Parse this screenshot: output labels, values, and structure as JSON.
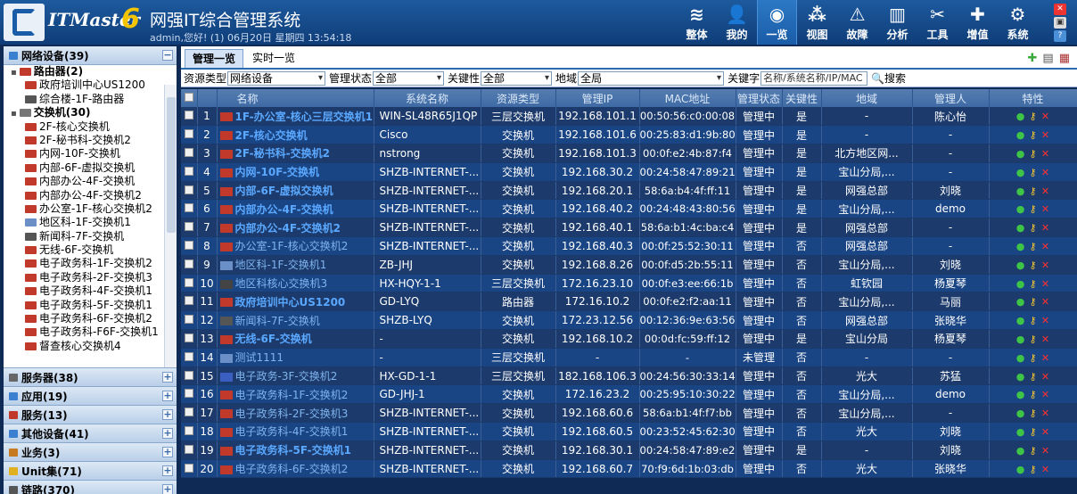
{
  "app": {
    "logo": "ITMaster",
    "version": "6",
    "title": "网强IT综合管理系统",
    "welcome": "admin,您好! (1) 06月20日 星期四 13:54:18"
  },
  "nav": [
    {
      "label": "整体",
      "icon": "layers-icon",
      "glyph": "≋"
    },
    {
      "label": "我的",
      "icon": "user-icon",
      "glyph": "👤"
    },
    {
      "label": "一览",
      "icon": "overview-icon",
      "glyph": "◉",
      "active": true
    },
    {
      "label": "视图",
      "icon": "topology-icon",
      "glyph": "⁂"
    },
    {
      "label": "故障",
      "icon": "warning-icon",
      "glyph": "⚠"
    },
    {
      "label": "分析",
      "icon": "chart-icon",
      "glyph": "▥"
    },
    {
      "label": "工具",
      "icon": "tools-icon",
      "glyph": "✂"
    },
    {
      "label": "增值",
      "icon": "plus-icon",
      "glyph": "✚"
    },
    {
      "label": "系统",
      "icon": "gear-icon",
      "glyph": "⚙"
    }
  ],
  "sidebar": {
    "header": "网络设备(39)",
    "tree": [
      {
        "label": "路由器(2)",
        "level": 0,
        "group": true,
        "color": "#c0392b"
      },
      {
        "label": "政府培训中心US1200",
        "level": 1,
        "color": "#c0392b"
      },
      {
        "label": "综合楼-1F-路由器",
        "level": 1,
        "color": "#555"
      },
      {
        "label": "交换机(30)",
        "level": 0,
        "group": true,
        "color": "#777"
      },
      {
        "label": "2F-核心交换机",
        "level": 1,
        "color": "#c0392b"
      },
      {
        "label": "2F-秘书科-交换机2",
        "level": 1,
        "color": "#c0392b"
      },
      {
        "label": "内网-10F-交换机",
        "level": 1,
        "color": "#c0392b"
      },
      {
        "label": "内部-6F-虚拟交换机",
        "level": 1,
        "color": "#c0392b"
      },
      {
        "label": "内部办公-4F-交换机",
        "level": 1,
        "color": "#c0392b"
      },
      {
        "label": "内部办公-4F-交换机2",
        "level": 1,
        "color": "#c0392b"
      },
      {
        "label": "办公室-1F-核心交换机2",
        "level": 1,
        "color": "#c0392b"
      },
      {
        "label": "地区科-1F-交换机1",
        "level": 1,
        "color": "#6b8fc7"
      },
      {
        "label": "新闻科-7F-交换机",
        "level": 1,
        "color": "#555"
      },
      {
        "label": "无线-6F-交换机",
        "level": 1,
        "color": "#c0392b"
      },
      {
        "label": "电子政务科-1F-交换机2",
        "level": 1,
        "color": "#c0392b"
      },
      {
        "label": "电子政务科-2F-交换机3",
        "level": 1,
        "color": "#c0392b"
      },
      {
        "label": "电子政务科-4F-交换机1",
        "level": 1,
        "color": "#c0392b"
      },
      {
        "label": "电子政务科-5F-交换机1",
        "level": 1,
        "color": "#c0392b"
      },
      {
        "label": "电子政务科-6F-交换机2",
        "level": 1,
        "color": "#c0392b"
      },
      {
        "label": "电子政务科-F6F-交换机1",
        "level": 1,
        "color": "#c0392b"
      },
      {
        "label": "督查核心交换机4",
        "level": 1,
        "color": "#c0392b"
      }
    ],
    "categories": [
      {
        "label": "服务器(38)",
        "color": "#666"
      },
      {
        "label": "应用(19)",
        "color": "#3a7fd0"
      },
      {
        "label": "服务(13)",
        "color": "#c0392b"
      },
      {
        "label": "其他设备(41)",
        "color": "#3a7fd0"
      },
      {
        "label": "业务(3)",
        "color": "#c87a20"
      },
      {
        "label": "Unit集(71)",
        "color": "#e0b020"
      },
      {
        "label": "链路(370)",
        "color": "#555"
      }
    ]
  },
  "tabs": [
    "管理一览",
    "实时一览"
  ],
  "filter": {
    "type_label": "资源类型",
    "type_value": "网络设备",
    "status_label": "管理状态",
    "status_value": "全部",
    "key_label": "关键性",
    "key_value": "全部",
    "region_label": "地域",
    "region_value": "全局",
    "keyword_label": "关键字",
    "keyword_placeholder": "名称/系统名称/IP/MAC",
    "search_label": "搜索"
  },
  "columns": [
    "名称",
    "系统名称",
    "资源类型",
    "管理IP",
    "MAC地址",
    "管理状态",
    "关键性",
    "地域",
    "管理人",
    "特性"
  ],
  "rows": [
    {
      "n": "1",
      "name": "1F-办公室-核心三层交换机1",
      "sys": "WIN-SL48R65J1QP",
      "type": "三层交换机",
      "ip": "192.168.101.1",
      "mac": "00:50:56:c0:00:08",
      "status": "管理中",
      "key": "是",
      "region": "-",
      "owner": "陈心怡",
      "icon": "#c0392b",
      "bold": true
    },
    {
      "n": "2",
      "name": "2F-核心交换机",
      "sys": "Cisco",
      "type": "交换机",
      "ip": "192.168.101.6",
      "mac": "00:25:83:d1:9b:80",
      "status": "管理中",
      "key": "是",
      "region": "-",
      "owner": "-",
      "icon": "#c0392b",
      "bold": true
    },
    {
      "n": "3",
      "name": "2F-秘书科-交换机2",
      "sys": "nstrong",
      "type": "交换机",
      "ip": "192.168.101.3",
      "mac": "00:0f:e2:4b:87:f4",
      "status": "管理中",
      "key": "是",
      "region": "北方地区网...",
      "owner": "-",
      "icon": "#c0392b",
      "bold": true
    },
    {
      "n": "4",
      "name": "内网-10F-交换机",
      "sys": "SHZB-INTERNET-...",
      "type": "交换机",
      "ip": "192.168.30.2",
      "mac": "00:24:58:47:89:21",
      "status": "管理中",
      "key": "是",
      "region": "宝山分局,...",
      "owner": "-",
      "icon": "#c0392b",
      "bold": true
    },
    {
      "n": "5",
      "name": "内部-6F-虚拟交换机",
      "sys": "SHZB-INTERNET-...",
      "type": "交换机",
      "ip": "192.168.20.1",
      "mac": "58:6a:b4:4f:ff:11",
      "status": "管理中",
      "key": "是",
      "region": "网强总部",
      "owner": "刘晓",
      "icon": "#c0392b",
      "bold": true
    },
    {
      "n": "6",
      "name": "内部办公-4F-交换机",
      "sys": "SHZB-INTERNET-...",
      "type": "交换机",
      "ip": "192.168.40.2",
      "mac": "00:24:48:43:80:56",
      "status": "管理中",
      "key": "是",
      "region": "宝山分局,...",
      "owner": "demo",
      "icon": "#c0392b",
      "bold": true
    },
    {
      "n": "7",
      "name": "内部办公-4F-交换机2",
      "sys": "SHZB-INTERNET-...",
      "type": "交换机",
      "ip": "192.168.40.1",
      "mac": "58:6a:b1:4c:ba:c4",
      "status": "管理中",
      "key": "是",
      "region": "网强总部",
      "owner": "-",
      "icon": "#c0392b",
      "bold": true
    },
    {
      "n": "8",
      "name": "办公室-1F-核心交换机2",
      "sys": "SHZB-INTERNET-...",
      "type": "交换机",
      "ip": "192.168.40.3",
      "mac": "00:0f:25:52:30:11",
      "status": "管理中",
      "key": "否",
      "region": "网强总部",
      "owner": "-",
      "icon": "#c0392b",
      "bold": false
    },
    {
      "n": "9",
      "name": "地区科-1F-交换机1",
      "sys": "ZB-JHJ",
      "type": "交换机",
      "ip": "192.168.8.26",
      "mac": "00:0f:d5:2b:55:11",
      "status": "管理中",
      "key": "否",
      "region": "宝山分局,...",
      "owner": "刘晓",
      "icon": "#6b8fc7",
      "bold": false
    },
    {
      "n": "10",
      "name": "地区科核心交换机3",
      "sys": "HX-HQY-1-1",
      "type": "三层交换机",
      "ip": "172.16.23.10",
      "mac": "00:0f:e3:ee:66:1b",
      "status": "管理中",
      "key": "否",
      "region": "虹钦园",
      "owner": "杨夏琴",
      "icon": "#444",
      "bold": false
    },
    {
      "n": "11",
      "name": "政府培训中心US1200",
      "sys": "GD-LYQ",
      "type": "路由器",
      "ip": "172.16.10.2",
      "mac": "00:0f:e2:f2:aa:11",
      "status": "管理中",
      "key": "否",
      "region": "宝山分局,...",
      "owner": "马丽",
      "icon": "#c0392b",
      "bold": true
    },
    {
      "n": "12",
      "name": "新闻科-7F-交换机",
      "sys": "SHZB-LYQ",
      "type": "交换机",
      "ip": "172.23.12.56",
      "mac": "00:12:36:9e:63:56",
      "status": "管理中",
      "key": "否",
      "region": "网强总部",
      "owner": "张晓华",
      "icon": "#555",
      "bold": false
    },
    {
      "n": "13",
      "name": "无线-6F-交换机",
      "sys": "-",
      "type": "交换机",
      "ip": "192.168.10.2",
      "mac": "00:0d:fc:59:ff:12",
      "status": "管理中",
      "key": "是",
      "region": "宝山分局",
      "owner": "杨夏琴",
      "icon": "#c0392b",
      "bold": true
    },
    {
      "n": "14",
      "name": "测试1111",
      "sys": "-",
      "type": "三层交换机",
      "ip": "-",
      "mac": "-",
      "status": "未管理",
      "key": "否",
      "region": "-",
      "owner": "-",
      "icon": "#6b8fc7",
      "bold": false
    },
    {
      "n": "15",
      "name": "电子政务-3F-交换机2",
      "sys": "HX-GD-1-1",
      "type": "三层交换机",
      "ip": "182.168.106.3",
      "mac": "00:24:56:30:33:14",
      "status": "管理中",
      "key": "否",
      "region": "光大",
      "owner": "苏猛",
      "icon": "#3a5fc0",
      "bold": false
    },
    {
      "n": "16",
      "name": "电子政务科-1F-交换机2",
      "sys": "GD-JHJ-1",
      "type": "交换机",
      "ip": "172.16.23.2",
      "mac": "00:25:95:10:30:22",
      "status": "管理中",
      "key": "否",
      "region": "宝山分局,...",
      "owner": "demo",
      "icon": "#c0392b",
      "bold": false
    },
    {
      "n": "17",
      "name": "电子政务科-2F-交换机3",
      "sys": "SHZB-INTERNET-...",
      "type": "交换机",
      "ip": "192.168.60.6",
      "mac": "58:6a:b1:4f:f7:bb",
      "status": "管理中",
      "key": "否",
      "region": "宝山分局,...",
      "owner": "-",
      "icon": "#c0392b",
      "bold": false
    },
    {
      "n": "18",
      "name": "电子政务科-4F-交换机1",
      "sys": "SHZB-INTERNET-...",
      "type": "交换机",
      "ip": "192.168.60.5",
      "mac": "00:23:52:45:62:30",
      "status": "管理中",
      "key": "否",
      "region": "光大",
      "owner": "刘晓",
      "icon": "#c0392b",
      "bold": false
    },
    {
      "n": "19",
      "name": "电子政务科-5F-交换机1",
      "sys": "SHZB-INTERNET-...",
      "type": "交换机",
      "ip": "192.168.30.1",
      "mac": "00:24:58:47:89:e2",
      "status": "管理中",
      "key": "是",
      "region": "-",
      "owner": "刘晓",
      "icon": "#c0392b",
      "bold": true
    },
    {
      "n": "20",
      "name": "电子政务科-6F-交换机2",
      "sys": "SHZB-INTERNET-...",
      "type": "交换机",
      "ip": "192.168.60.7",
      "mac": "70:f9:6d:1b:03:db",
      "status": "管理中",
      "key": "否",
      "region": "光大",
      "owner": "张晓华",
      "icon": "#c0392b",
      "bold": false
    }
  ]
}
